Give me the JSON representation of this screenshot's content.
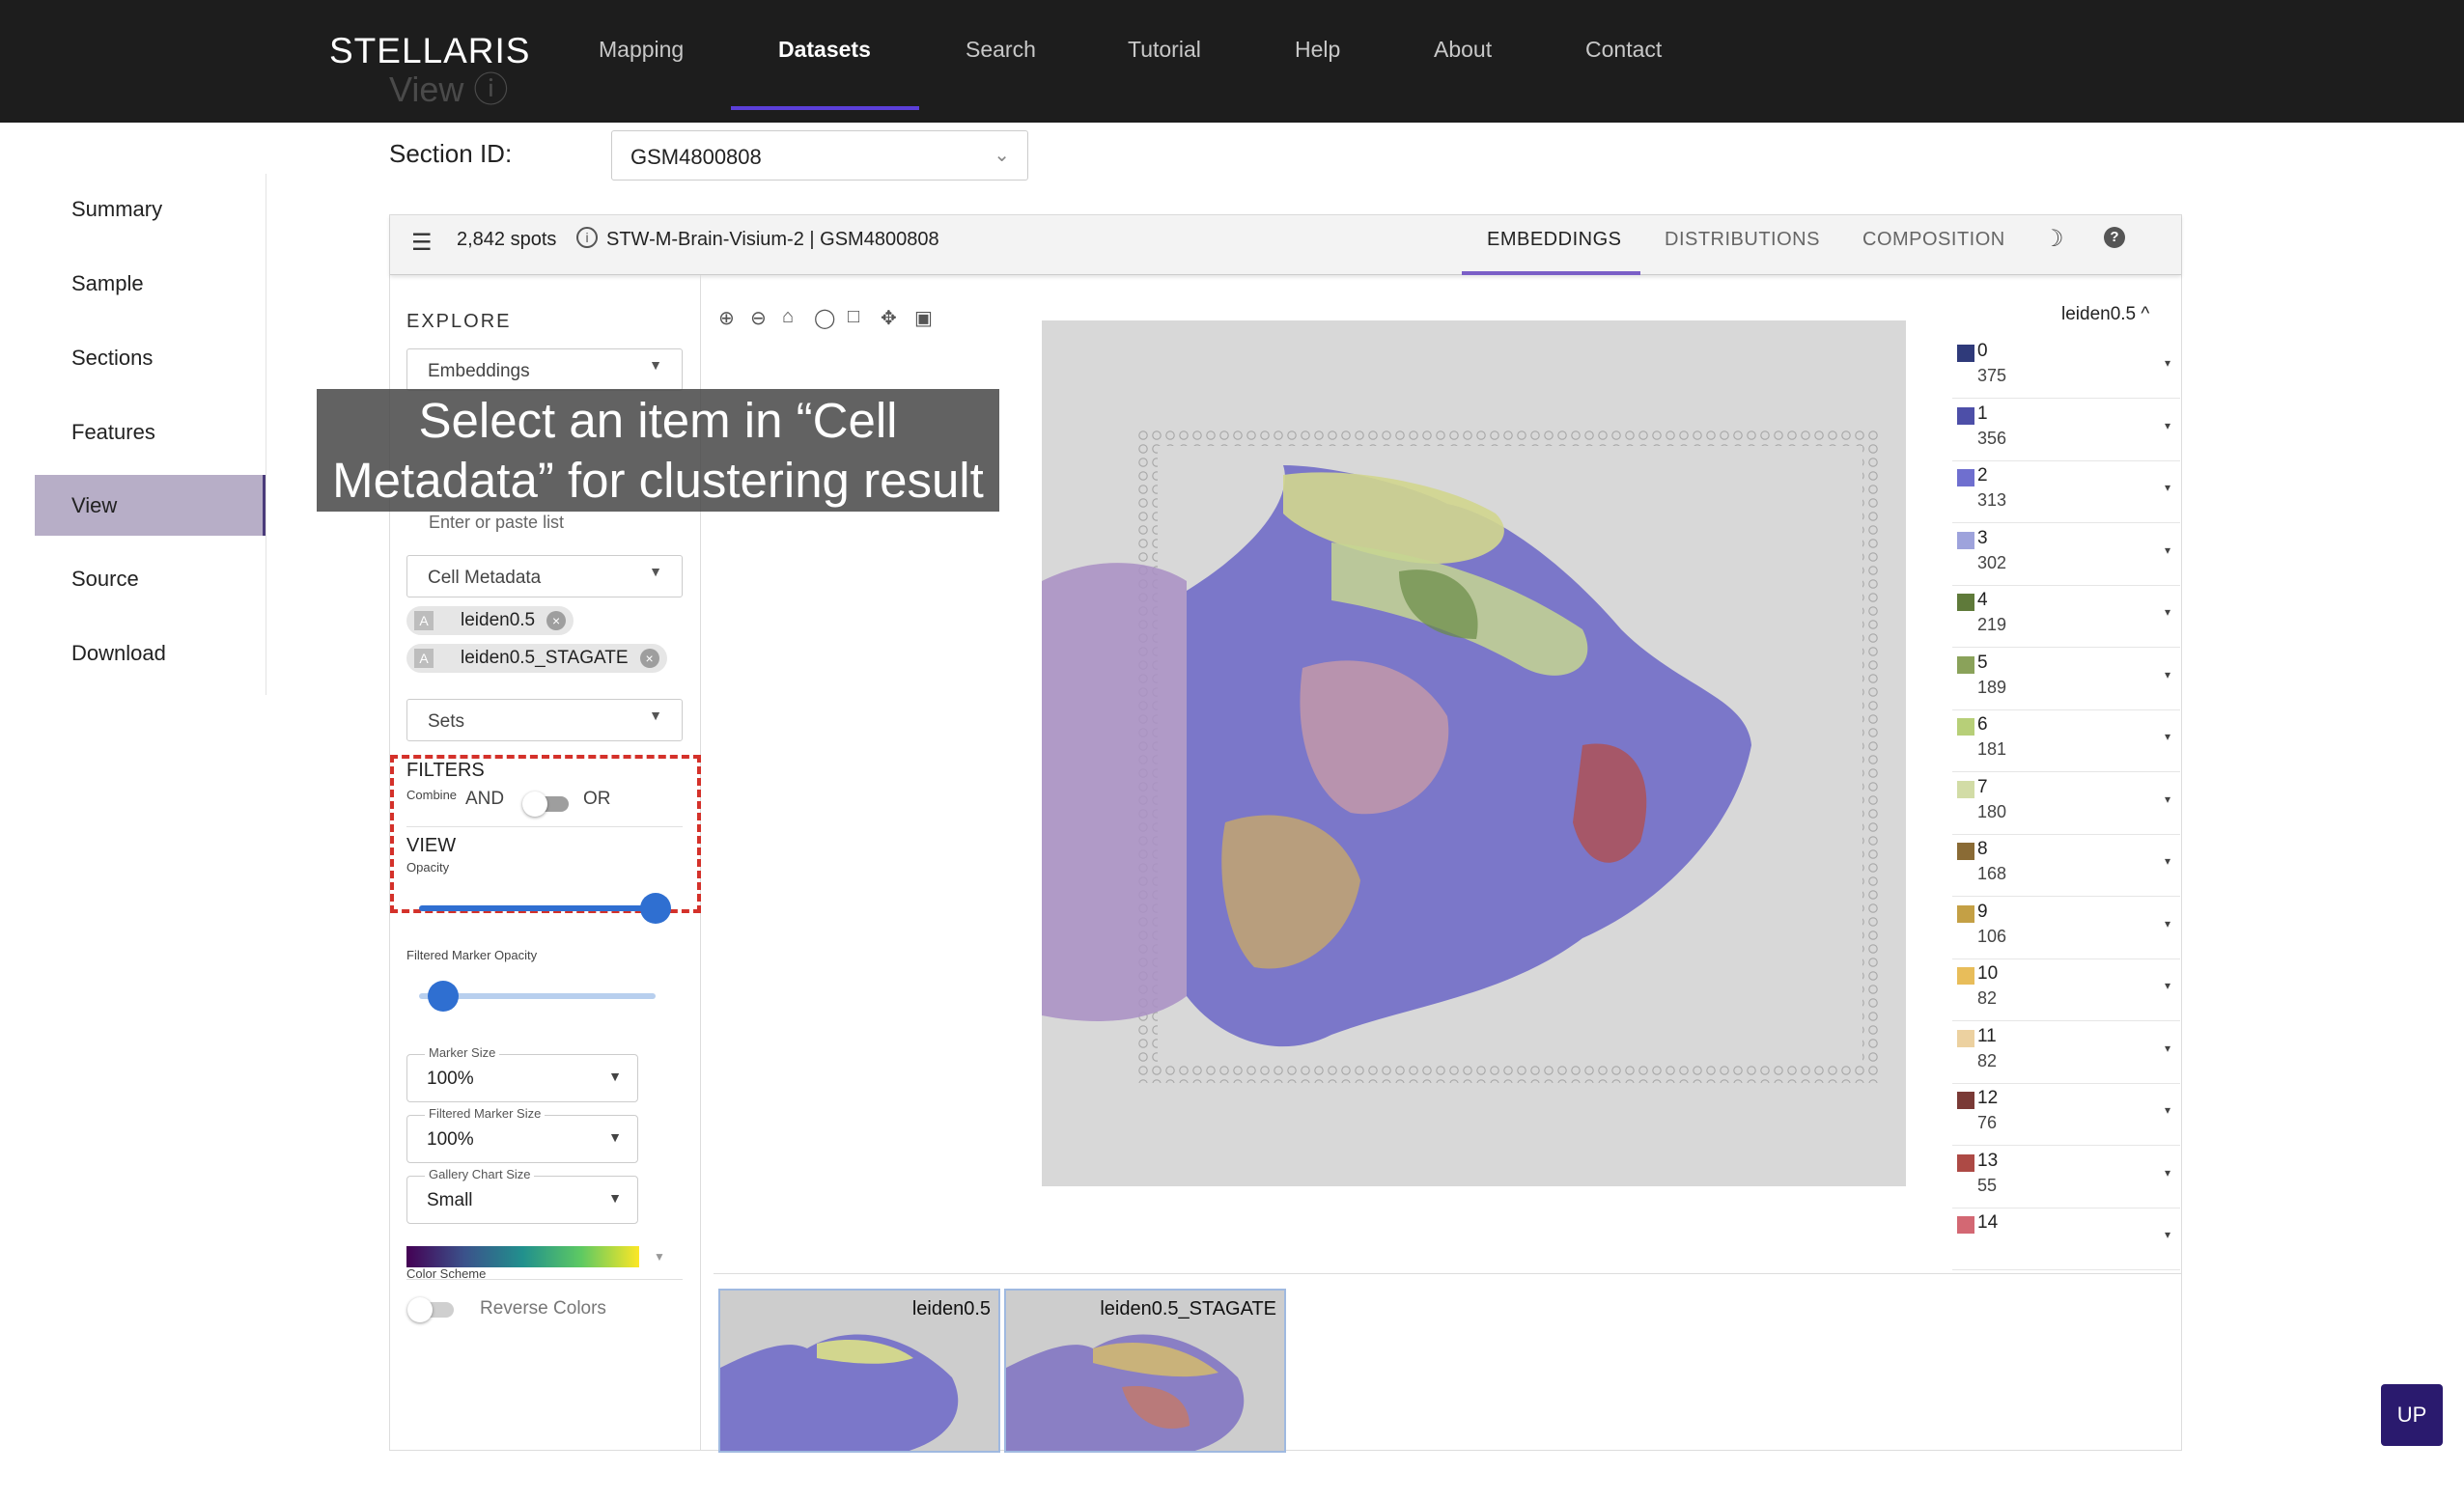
{
  "nav": {
    "brand": "STELLARIS",
    "links": [
      "Mapping",
      "Datasets",
      "Search",
      "Tutorial",
      "Help",
      "About",
      "Contact"
    ],
    "active": "Datasets"
  },
  "page": {
    "ghost_title": "View ⓘ"
  },
  "sidebar": {
    "items": [
      "Summary",
      "Sample",
      "Sections",
      "Features",
      "View",
      "Source",
      "Download"
    ],
    "active": "View"
  },
  "section": {
    "label": "Section ID:",
    "value": "GSM4800808"
  },
  "toolbar": {
    "spots": "2,842 spots",
    "dataset": "STW-M-Brain-Visium-2 | GSM4800808",
    "tabs": [
      "EMBEDDINGS",
      "DISTRIBUTIONS",
      "COMPOSITION"
    ],
    "active_tab": "EMBEDDINGS"
  },
  "controls": {
    "explore_label": "EXPLORE",
    "embeddings_value": "Embeddings",
    "paste_hint": "Enter or paste list",
    "cell_metadata_value": "Cell Metadata",
    "chips": [
      "leiden0.5",
      "leiden0.5_STAGATE"
    ],
    "sets_value": "Sets",
    "filters_label": "FILTERS",
    "combine_label": "Combine",
    "and_label": "AND",
    "or_label": "OR",
    "view_label": "VIEW",
    "opacity_label": "Opacity",
    "opacity_value": 1.0,
    "filtered_opacity_label": "Filtered Marker Opacity",
    "filtered_opacity_value": 0.1,
    "marker_size_label": "Marker Size",
    "marker_size_value": "100%",
    "filtered_marker_size_label": "Filtered Marker Size",
    "filtered_marker_size_value": "100%",
    "gallery_size_label": "Gallery Chart Size",
    "gallery_size_value": "Small",
    "color_scheme_label": "Color Scheme",
    "reverse_label": "Reverse Colors"
  },
  "legend": {
    "title": "leiden0.5 ^",
    "items": [
      {
        "name": "0",
        "count": "375",
        "color": "#2f3a7a"
      },
      {
        "name": "1",
        "count": "356",
        "color": "#4d4fa8"
      },
      {
        "name": "2",
        "count": "313",
        "color": "#6f6fcf"
      },
      {
        "name": "3",
        "count": "302",
        "color": "#9ea3dc"
      },
      {
        "name": "4",
        "count": "219",
        "color": "#5f7a3a"
      },
      {
        "name": "5",
        "count": "189",
        "color": "#8aa25a"
      },
      {
        "name": "6",
        "count": "181",
        "color": "#b7cf78"
      },
      {
        "name": "7",
        "count": "180",
        "color": "#d2dca6"
      },
      {
        "name": "8",
        "count": "168",
        "color": "#8a6b35"
      },
      {
        "name": "9",
        "count": "106",
        "color": "#c4a045"
      },
      {
        "name": "10",
        "count": "82",
        "color": "#e8bd5a"
      },
      {
        "name": "11",
        "count": "82",
        "color": "#ecd1a0"
      },
      {
        "name": "12",
        "count": "76",
        "color": "#7a3a36"
      },
      {
        "name": "13",
        "count": "55",
        "color": "#ad4a45"
      },
      {
        "name": "14",
        "count": "",
        "color": "#d36873"
      }
    ]
  },
  "gallery": [
    "leiden0.5",
    "leiden0.5_STAGATE"
  ],
  "annotation": {
    "line1": "Select an item in “Cell",
    "line2": "Metadata” for clustering result"
  },
  "up_button": "UP",
  "icons": [
    "zoom-in-icon",
    "zoom-out-icon",
    "home-icon",
    "lasso-icon",
    "box-select-icon",
    "pan-icon",
    "camera-icon",
    "menu-icon",
    "info-icon",
    "moon-icon",
    "help-icon"
  ]
}
